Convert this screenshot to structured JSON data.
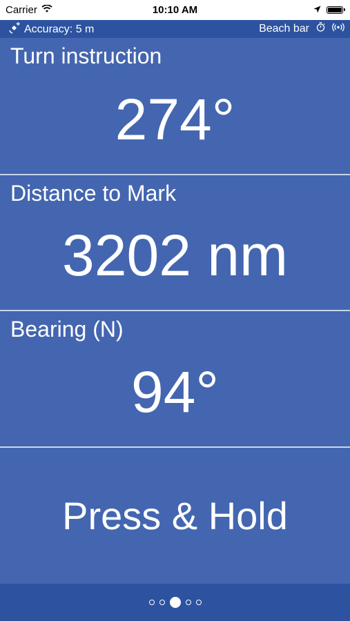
{
  "status_bar": {
    "carrier": "Carrier",
    "time": "10:10 AM"
  },
  "info_bar": {
    "accuracy": "Accuracy: 5 m",
    "destination": "Beach bar"
  },
  "panels": [
    {
      "label": "Turn instruction",
      "value": "274°"
    },
    {
      "label": "Distance to Mark",
      "value": "3202 nm"
    },
    {
      "label": "Bearing (N)",
      "value": "94°"
    }
  ],
  "press_hold_label": "Press & Hold",
  "pager": {
    "count": 5,
    "active_index": 2
  },
  "colors": {
    "background": "#4466b0",
    "bar": "#2d52a0",
    "divider": "#c9d4ec",
    "text": "#ffffff"
  }
}
